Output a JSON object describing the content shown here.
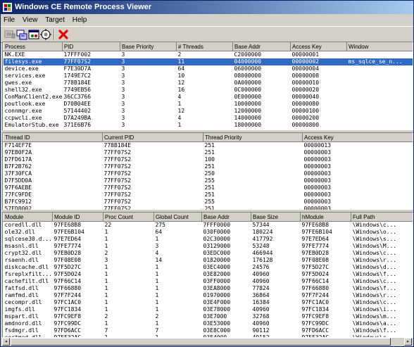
{
  "window": {
    "title": "Windows CE Remote Process Viewer"
  },
  "menu": {
    "items": [
      "File",
      "View",
      "Target",
      "Help"
    ]
  },
  "toolbar": {
    "buttons": [
      "connect-icon",
      "refresh-icon",
      "process-icon",
      "settings-icon",
      "kill-icon"
    ]
  },
  "processes": {
    "headers": [
      "Process",
      "PID",
      "Base Priority",
      "# Threads",
      "Base Addr",
      "Access Key",
      "Window"
    ],
    "rows": [
      [
        "NK.EXE",
        "17FFF002",
        "3",
        "2",
        "C2000000",
        "00000001",
        ""
      ],
      [
        "filesys.exe",
        "77FF07S2",
        "3",
        "11",
        "04000000",
        "00000002",
        "ms_sqlce_se_n..."
      ],
      [
        "device.exe",
        "F7E30D7A",
        "3",
        "64",
        "06000000",
        "00000004",
        ""
      ],
      [
        "services.exe",
        "1749E7C2",
        "3",
        "10",
        "08000000",
        "00000008",
        ""
      ],
      [
        "gwes.exe",
        "778B184E",
        "3",
        "12",
        "0A000000",
        "00000010",
        ""
      ],
      [
        "shell32.exe",
        "7749EB56",
        "3",
        "16",
        "0C000000",
        "00000020",
        ""
      ],
      [
        "ConManClient2.exe",
        "36CC3766",
        "3",
        "4",
        "0E000000",
        "00000040",
        ""
      ],
      [
        "poutlook.exe",
        "D70B04EE",
        "3",
        "1",
        "10000000",
        "00000080",
        ""
      ],
      [
        "connmgr.exe",
        "57144402",
        "3",
        "12",
        "12000000",
        "00000100",
        ""
      ],
      [
        "ccpwcli.exe",
        "D7A249BA",
        "3",
        "4",
        "14000000",
        "00000200",
        ""
      ],
      [
        "EmulatorStub.exe",
        "371E6B76",
        "3",
        "1",
        "18000000",
        "00000800",
        ""
      ]
    ],
    "selected_row": 1
  },
  "threads": {
    "headers": [
      "Thread ID",
      "Current PID",
      "Thread Priority",
      "Access Key"
    ],
    "rows": [
      [
        "F714EF7E",
        "778B184E",
        "251",
        "00000013"
      ],
      [
        "97EB0F2A",
        "77FF07S2",
        "251",
        "00000003"
      ],
      [
        "D7FD617A",
        "77FF07S2",
        "100",
        "00000003"
      ],
      [
        "B7F2B762",
        "77FF07S2",
        "251",
        "00000003"
      ],
      [
        "37F30FCA",
        "77FF07S2",
        "250",
        "00000003"
      ],
      [
        "D7F5DD0A",
        "77FF07S2",
        "255",
        "00000003"
      ],
      [
        "97F6AEBE",
        "77FF07S2",
        "251",
        "00000003"
      ],
      [
        "77FC9FDE",
        "77FF07S2",
        "251",
        "00000003"
      ],
      [
        "B7FC9912",
        "77FF07S2",
        "255",
        "00000003"
      ],
      [
        "57FD8002",
        "77FF07S2",
        "251",
        "00000003"
      ]
    ]
  },
  "modules": {
    "headers": [
      "Module",
      "Module ID",
      "Proc Count",
      "Global Count",
      "Base Addr",
      "Base Size",
      "hModule",
      "Full Path"
    ],
    "rows": [
      [
        "coredll.dll",
        "97FE68B8",
        "22",
        "275",
        "7FFF0000",
        "57344",
        "97FE68B8",
        "\\Windows\\c..."
      ],
      [
        "ole32.dll",
        "97FE6B104",
        "1",
        "64",
        "030F0000",
        "180224",
        "97FE6B104",
        "\\Windows\\o..."
      ],
      [
        "sqlcese30.d...",
        "97E7ED64",
        "1",
        "1",
        "02C30000",
        "417792",
        "97E7ED64",
        "\\Windows\\s..."
      ],
      [
        "msasnl.dll",
        "97FE7774",
        "1",
        "3",
        "03129000",
        "53248",
        "97FE7774",
        "\\Windows\\M..."
      ],
      [
        "crypt32.dll",
        "97EB0D28",
        "2",
        "4",
        "03EDC000",
        "466944",
        "97EB0D28",
        "\\Windows\\c..."
      ],
      [
        "rsaenh.dll",
        "97F08E08",
        "3",
        "14",
        "01820000",
        "176128",
        "97F08E08",
        "\\Windows\\r..."
      ],
      [
        "diskcache.dll",
        "97F5D27C",
        "1",
        "1",
        "03EC4000",
        "24576",
        "97F5D27C",
        "\\Windows\\d..."
      ],
      [
        "fsreplxfilt...",
        "97F5D024",
        "1",
        "1",
        "03E82000",
        "40960",
        "97F5D024",
        "\\Windows\\f..."
      ],
      [
        "cachefilt.dll",
        "97F66C14",
        "1",
        "1",
        "03FF0000",
        "40960",
        "97F66C14",
        "\\Windows\\c..."
      ],
      [
        "fatfsd.dll",
        "97F66880",
        "1",
        "1",
        "03EA8000",
        "77824",
        "97F66880",
        "\\Windows\\f..."
      ],
      [
        "ramfmd.dll",
        "97F7F244",
        "1",
        "1",
        "01970000",
        "36864",
        "97F7F244",
        "\\Windows\\r..."
      ],
      [
        "cecompr.dll",
        "97FC1AC0",
        "1",
        "1",
        "03E4F000",
        "16384",
        "97FC1AC0",
        "\\Windows\\c..."
      ],
      [
        "imgfs.dll",
        "97FC1834",
        "1",
        "1",
        "03E78000",
        "40960",
        "97FC1834",
        "\\Windows\\i..."
      ],
      [
        "mspart.dll",
        "97FC9EF8",
        "2",
        "2",
        "03E7000",
        "32768",
        "97FC9EF8",
        "\\Windows\\m..."
      ],
      [
        "amdnord.dll",
        "97FC99DC",
        "1",
        "1",
        "03E53000",
        "40960",
        "97FC99DC",
        "\\Windows\\a..."
      ],
      [
        "fsdmgr.dll",
        "97FD6ACC",
        "7",
        "7",
        "03E8C000",
        "90112",
        "97FD6ACC",
        "\\Windows\\f..."
      ],
      [
        "certmod.dll",
        "97FF32AC",
        "1",
        "1",
        "03F4000",
        "49152",
        "97FF32AC",
        "\\Windows\\c..."
      ],
      [
        "coredll.dll",
        "97FFFFE0",
        "22",
        "275",
        "03F4E000",
        "614400",
        "97FFFFE0",
        "\\Windows\\c..."
      ]
    ]
  }
}
